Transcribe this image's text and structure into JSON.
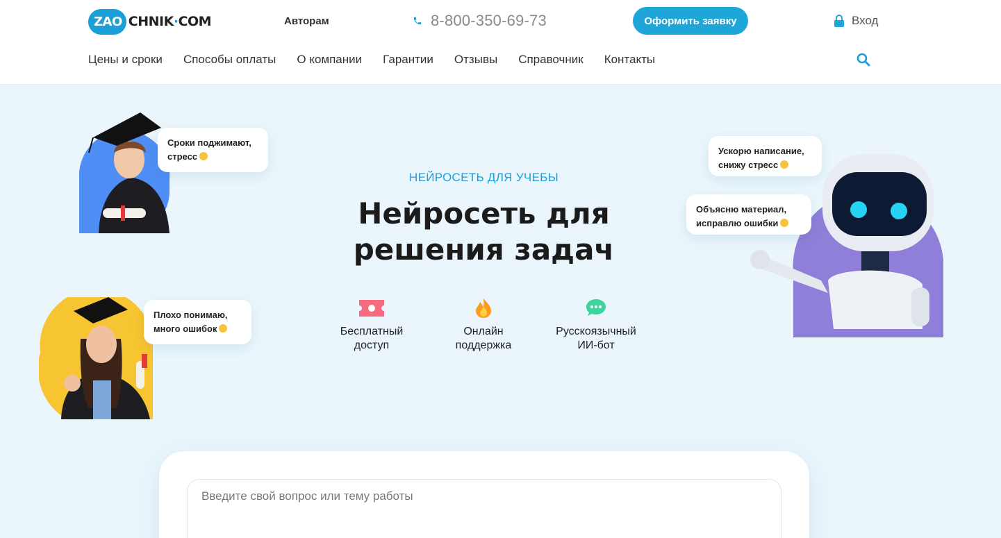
{
  "header": {
    "logo": {
      "badge": "ZAO",
      "rest": "CHNIK",
      "dot": "·",
      "tld": "COM"
    },
    "authors_link": "Авторам",
    "phone": "8-800-350-69-73",
    "order_button": "Оформить заявку",
    "login": "Вход",
    "nav": [
      "Цены и сроки",
      "Способы оплаты",
      "О компании",
      "Гарантии",
      "Отзывы",
      "Справочник",
      "Контакты"
    ]
  },
  "hero": {
    "subtitle": "НЕЙРОСЕТЬ ДЛЯ УЧЕБЫ",
    "title_line1": "Нейросеть для",
    "title_line2": "решения задач",
    "features": [
      {
        "line1": "Бесплатный",
        "line2": "доступ",
        "icon": "ticket-icon"
      },
      {
        "line1": "Онлайн",
        "line2": "поддержка",
        "icon": "fire-icon"
      },
      {
        "line1": "Русскоязычный",
        "line2": "ИИ-бот",
        "icon": "chat-bubble-icon"
      }
    ]
  },
  "bubbles": {
    "student_top": {
      "line1": "Сроки поджимают,",
      "line2": "стресс"
    },
    "student_bottom": {
      "line1": "Плохо понимаю,",
      "line2": "много ошибок"
    },
    "robot_top": {
      "line1": "Ускорю написание,",
      "line2": "снижу стресс"
    },
    "robot_bottom": {
      "line1": "Объясню материал,",
      "line2": "исправлю ошибки"
    }
  },
  "chat": {
    "placeholder": "Введите свой вопрос или тему работы"
  },
  "colors": {
    "accent": "#1fa6d9",
    "background": "#eaf6fc",
    "student_circle_blue": "#4f8ff5",
    "student_circle_yellow": "#f7c531",
    "robot_circle": "#8f7fd8"
  }
}
